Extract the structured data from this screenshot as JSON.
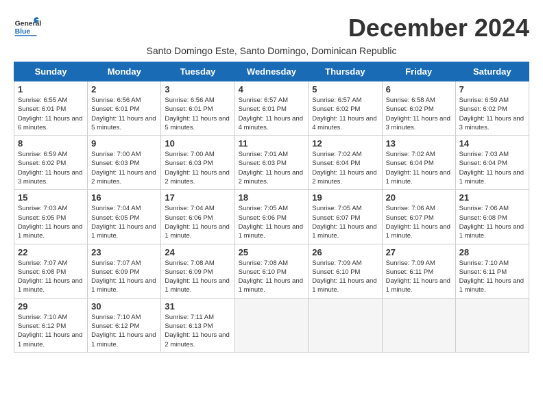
{
  "header": {
    "logo_general": "General",
    "logo_blue": "Blue",
    "month_title": "December 2024",
    "subtitle": "Santo Domingo Este, Santo Domingo, Dominican Republic"
  },
  "days_of_week": [
    "Sunday",
    "Monday",
    "Tuesday",
    "Wednesday",
    "Thursday",
    "Friday",
    "Saturday"
  ],
  "weeks": [
    [
      {
        "day": "1",
        "info": "Sunrise: 6:55 AM\nSunset: 6:01 PM\nDaylight: 11 hours and 6 minutes."
      },
      {
        "day": "2",
        "info": "Sunrise: 6:56 AM\nSunset: 6:01 PM\nDaylight: 11 hours and 5 minutes."
      },
      {
        "day": "3",
        "info": "Sunrise: 6:56 AM\nSunset: 6:01 PM\nDaylight: 11 hours and 5 minutes."
      },
      {
        "day": "4",
        "info": "Sunrise: 6:57 AM\nSunset: 6:01 PM\nDaylight: 11 hours and 4 minutes."
      },
      {
        "day": "5",
        "info": "Sunrise: 6:57 AM\nSunset: 6:02 PM\nDaylight: 11 hours and 4 minutes."
      },
      {
        "day": "6",
        "info": "Sunrise: 6:58 AM\nSunset: 6:02 PM\nDaylight: 11 hours and 3 minutes."
      },
      {
        "day": "7",
        "info": "Sunrise: 6:59 AM\nSunset: 6:02 PM\nDaylight: 11 hours and 3 minutes."
      }
    ],
    [
      {
        "day": "8",
        "info": "Sunrise: 6:59 AM\nSunset: 6:02 PM\nDaylight: 11 hours and 3 minutes."
      },
      {
        "day": "9",
        "info": "Sunrise: 7:00 AM\nSunset: 6:03 PM\nDaylight: 11 hours and 2 minutes."
      },
      {
        "day": "10",
        "info": "Sunrise: 7:00 AM\nSunset: 6:03 PM\nDaylight: 11 hours and 2 minutes."
      },
      {
        "day": "11",
        "info": "Sunrise: 7:01 AM\nSunset: 6:03 PM\nDaylight: 11 hours and 2 minutes."
      },
      {
        "day": "12",
        "info": "Sunrise: 7:02 AM\nSunset: 6:04 PM\nDaylight: 11 hours and 2 minutes."
      },
      {
        "day": "13",
        "info": "Sunrise: 7:02 AM\nSunset: 6:04 PM\nDaylight: 11 hours and 1 minute."
      },
      {
        "day": "14",
        "info": "Sunrise: 7:03 AM\nSunset: 6:04 PM\nDaylight: 11 hours and 1 minute."
      }
    ],
    [
      {
        "day": "15",
        "info": "Sunrise: 7:03 AM\nSunset: 6:05 PM\nDaylight: 11 hours and 1 minute."
      },
      {
        "day": "16",
        "info": "Sunrise: 7:04 AM\nSunset: 6:05 PM\nDaylight: 11 hours and 1 minute."
      },
      {
        "day": "17",
        "info": "Sunrise: 7:04 AM\nSunset: 6:06 PM\nDaylight: 11 hours and 1 minute."
      },
      {
        "day": "18",
        "info": "Sunrise: 7:05 AM\nSunset: 6:06 PM\nDaylight: 11 hours and 1 minute."
      },
      {
        "day": "19",
        "info": "Sunrise: 7:05 AM\nSunset: 6:07 PM\nDaylight: 11 hours and 1 minute."
      },
      {
        "day": "20",
        "info": "Sunrise: 7:06 AM\nSunset: 6:07 PM\nDaylight: 11 hours and 1 minute."
      },
      {
        "day": "21",
        "info": "Sunrise: 7:06 AM\nSunset: 6:08 PM\nDaylight: 11 hours and 1 minute."
      }
    ],
    [
      {
        "day": "22",
        "info": "Sunrise: 7:07 AM\nSunset: 6:08 PM\nDaylight: 11 hours and 1 minute."
      },
      {
        "day": "23",
        "info": "Sunrise: 7:07 AM\nSunset: 6:09 PM\nDaylight: 11 hours and 1 minute."
      },
      {
        "day": "24",
        "info": "Sunrise: 7:08 AM\nSunset: 6:09 PM\nDaylight: 11 hours and 1 minute."
      },
      {
        "day": "25",
        "info": "Sunrise: 7:08 AM\nSunset: 6:10 PM\nDaylight: 11 hours and 1 minute."
      },
      {
        "day": "26",
        "info": "Sunrise: 7:09 AM\nSunset: 6:10 PM\nDaylight: 11 hours and 1 minute."
      },
      {
        "day": "27",
        "info": "Sunrise: 7:09 AM\nSunset: 6:11 PM\nDaylight: 11 hours and 1 minute."
      },
      {
        "day": "28",
        "info": "Sunrise: 7:10 AM\nSunset: 6:11 PM\nDaylight: 11 hours and 1 minute."
      }
    ],
    [
      {
        "day": "29",
        "info": "Sunrise: 7:10 AM\nSunset: 6:12 PM\nDaylight: 11 hours and 1 minute."
      },
      {
        "day": "30",
        "info": "Sunrise: 7:10 AM\nSunset: 6:12 PM\nDaylight: 11 hours and 1 minute."
      },
      {
        "day": "31",
        "info": "Sunrise: 7:11 AM\nSunset: 6:13 PM\nDaylight: 11 hours and 2 minutes."
      },
      null,
      null,
      null,
      null
    ]
  ]
}
